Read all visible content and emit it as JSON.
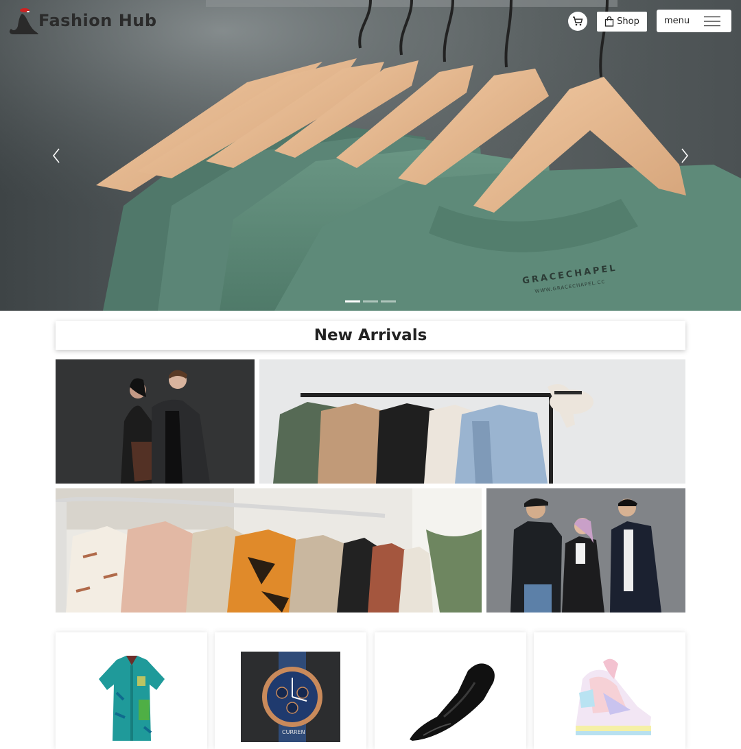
{
  "brand": {
    "name": "Fashion Hub",
    "logo_icon": "figure-with-red-hat-logo"
  },
  "nav": {
    "cart_icon": "cart-icon",
    "shop_label": "Shop",
    "shop_icon": "shopping-bag-icon",
    "menu_label": "menu",
    "menu_icon": "hamburger-icon"
  },
  "carousel": {
    "slide_text_line1": "GRACECHAPEL",
    "slide_text_line2": "WWW.GRACECHAPEL.CC",
    "slides_count": 3,
    "active_slide": 1,
    "prev_icon": "chevron-left-icon",
    "next_icon": "chevron-right-icon"
  },
  "new_arrivals": {
    "title": "New Arrivals",
    "tiles": [
      {
        "subject": "couple-in-dark-coats"
      },
      {
        "subject": "jackets-on-rack-with-hat"
      },
      {
        "subject": "blouses-on-rack"
      },
      {
        "subject": "three-friends-in-jackets"
      }
    ]
  },
  "products": [
    {
      "subject": "teal-patterned-shirt"
    },
    {
      "subject": "blue-chronograph-watch",
      "brand_text": "CURREN"
    },
    {
      "subject": "black-leather-loafer"
    },
    {
      "subject": "pastel-sneakers"
    }
  ],
  "colors": {
    "hero_shirt": "#5d8a78",
    "hanger_wood": "#e3b58c",
    "background": "#ffffff"
  }
}
